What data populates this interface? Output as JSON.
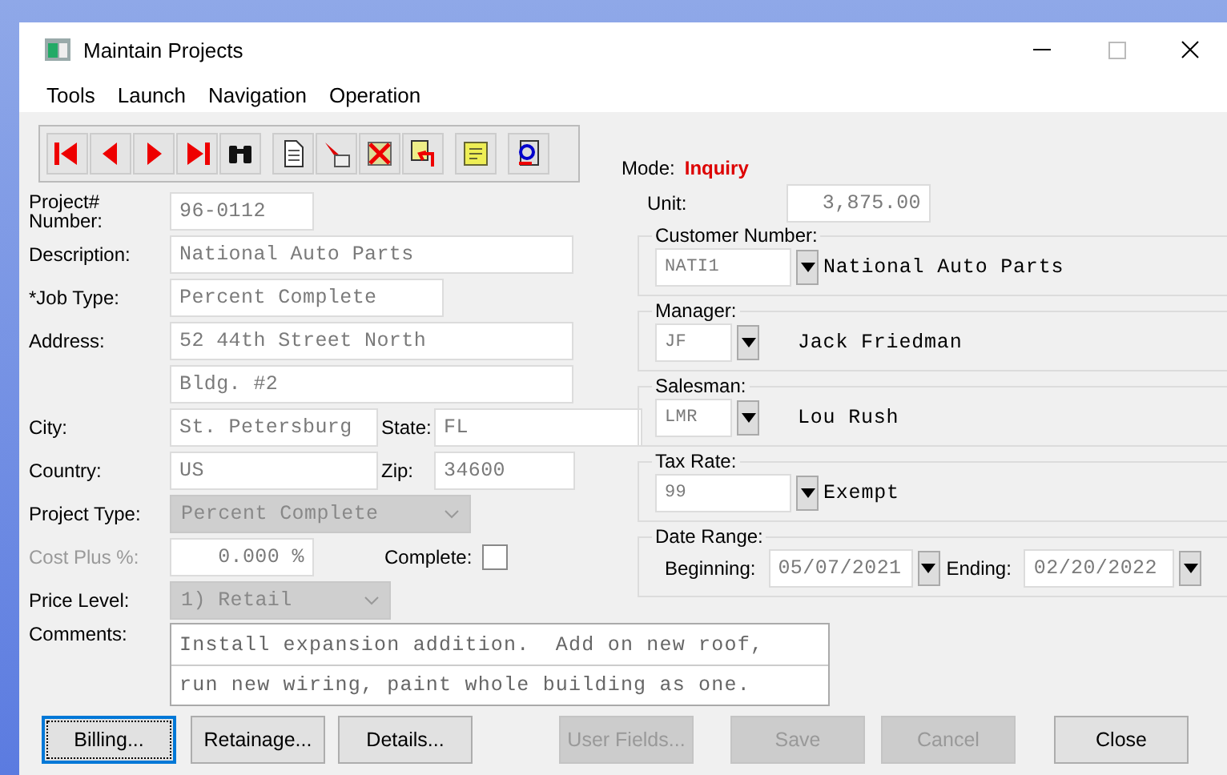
{
  "window": {
    "title": "Maintain Projects"
  },
  "menu": [
    "Tools",
    "Launch",
    "Navigation",
    "Operation"
  ],
  "mode": {
    "label": "Mode:",
    "value": "Inquiry"
  },
  "rows": [
    {
      "kind": "text",
      "label": "Project# Number:",
      "value": "96-0112"
    },
    {
      "kind": "text",
      "label": "Description:",
      "value": "National Auto Parts"
    },
    {
      "kind": "text",
      "label": "*Job Type:",
      "value": "Percent Complete"
    },
    {
      "kind": "text",
      "label": "Address:",
      "value": "52 44th Street North"
    },
    {
      "kind": "text",
      "value": "Bldg. #2"
    },
    {
      "kind": "pair",
      "fields": [
        {
          "label": "City:",
          "value": "St. Petersburg"
        },
        {
          "label": "State:",
          "value": "FL"
        }
      ]
    },
    {
      "kind": "pair",
      "fields": [
        {
          "label": "Country:",
          "value": "US"
        },
        {
          "label": "Zip:",
          "value": "34600"
        }
      ]
    },
    {
      "kind": "select",
      "label": "Project Type:",
      "value": "Percent Complete",
      "disabled": true
    },
    {
      "kind": "percent",
      "label": "Cost Plus %:",
      "disabled": true,
      "value": "0.000 %",
      "checkbox": {
        "label": "Complete:",
        "checked": false
      }
    },
    {
      "kind": "select",
      "label": "Price Level:",
      "value": "1) Retail",
      "disabled": true
    }
  ],
  "unit": {
    "label": "Unit:",
    "value": "3,875.00"
  },
  "lookups": [
    {
      "label": "Customer Number:",
      "code": "NATI1",
      "name": "National Auto Parts"
    },
    {
      "label": "Manager:",
      "code": "JF",
      "name": "Jack Friedman"
    },
    {
      "label": "Salesman:",
      "code": "LMR",
      "name": "Lou Rush"
    },
    {
      "label": "Tax Rate:",
      "code": "99",
      "name": "Exempt"
    }
  ],
  "date_range": {
    "label": "Date Range:",
    "beginning": {
      "label": "Beginning:",
      "value": "05/07/2021"
    },
    "ending": {
      "label": "Ending:",
      "value": "02/20/2022"
    }
  },
  "comments": {
    "label": "Comments:",
    "lines": [
      "Install expansion addition.  Add on new roof,",
      "run new wiring, paint whole building as one."
    ]
  },
  "buttons": [
    {
      "label": "Billing...",
      "disabled": false,
      "focused": true
    },
    {
      "label": "Retainage...",
      "disabled": false,
      "focused": false
    },
    {
      "label": "Details...",
      "disabled": false,
      "focused": false
    },
    {
      "label": "User Fields...",
      "disabled": true,
      "focused": false
    },
    {
      "label": "Save",
      "disabled": true,
      "focused": false
    },
    {
      "label": "Cancel",
      "disabled": true,
      "focused": false
    },
    {
      "label": "Close",
      "disabled": false,
      "focused": false
    }
  ]
}
